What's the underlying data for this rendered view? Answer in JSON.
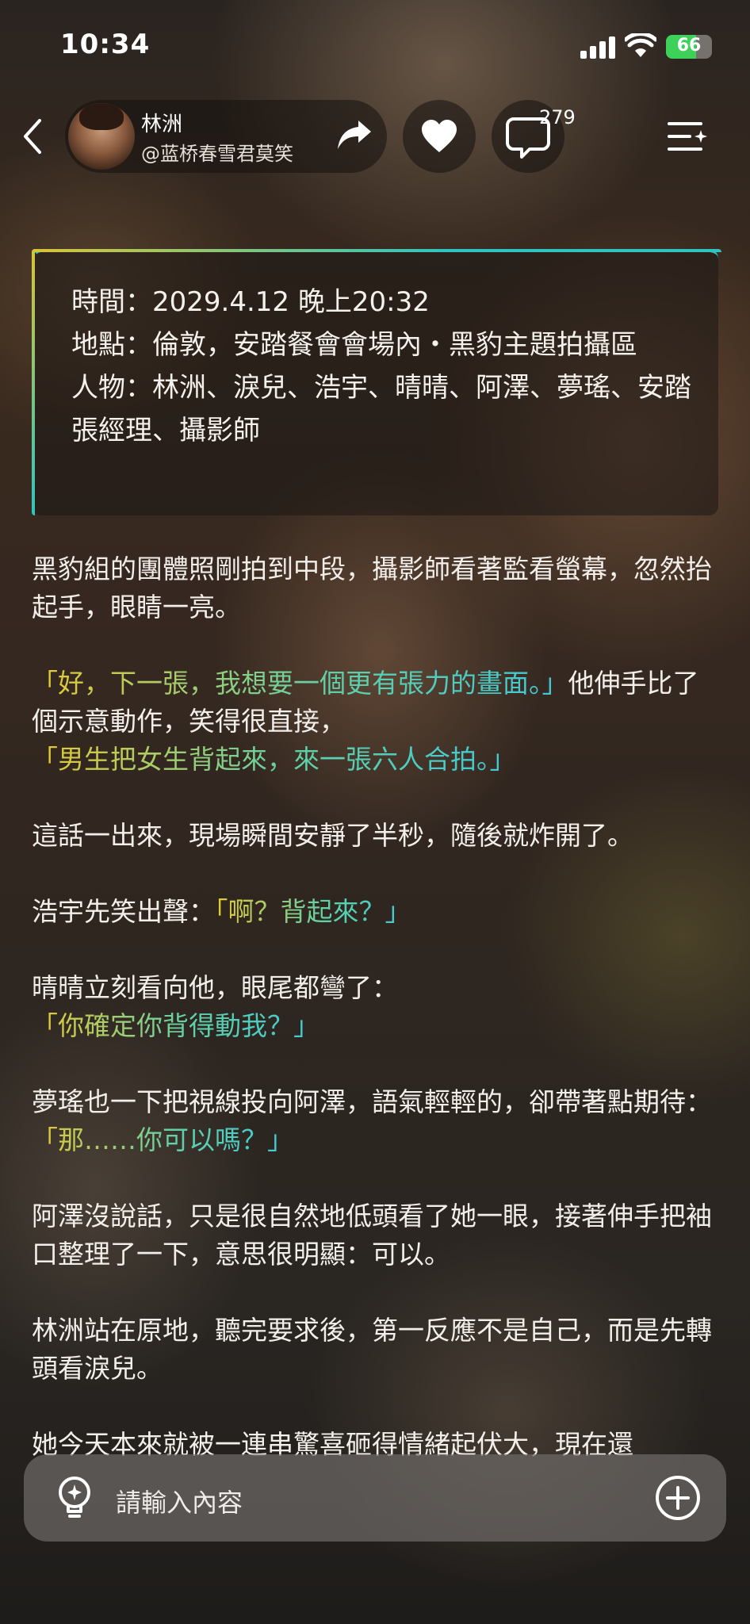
{
  "status": {
    "time": "10:34",
    "battery": "66"
  },
  "header": {
    "author_name": "林洲",
    "author_handle": "@蓝桥春雪君莫笑",
    "comment_count": "279"
  },
  "info": {
    "time_line": "時間：2029.4.12  晚上20:32",
    "place_line": "地點：倫敦，安踏餐會會場內・黑豹主題拍攝區",
    "people_line": "人物：林洲、淚兒、浩宇、晴晴、阿澤、夢瑤、安踏張經理、攝影師"
  },
  "story": {
    "p1": "黑豹組的團體照剛拍到中段，攝影師看著監看螢幕，忽然抬起手，眼睛一亮。",
    "p2_dialog": "「好，下一張，我想要一個更有張力的畫面。」",
    "p2_narr": "他伸手比了個示意動作，笑得很直接，",
    "p2_dialog2": "「男生把女生背起來，來一張六人合拍。」",
    "p3": "這話一出來，現場瞬間安靜了半秒，隨後就炸開了。",
    "p4_narr": "浩宇先笑出聲：",
    "p4_dialog": "「啊？背起來？」",
    "p5_narr": "晴晴立刻看向他，眼尾都彎了：",
    "p5_dialog": "「你確定你背得動我？」",
    "p6_narr": "夢瑤也一下把視線投向阿澤，語氣輕輕的，卻帶著點期待：",
    "p6_dialog": "「那……你可以嗎？」",
    "p7": "阿澤沒說話，只是很自然地低頭看了她一眼，接著伸手把袖口整理了一下，意思很明顯：可以。",
    "p8": "林洲站在原地，聽完要求後，第一反應不是自己，而是先轉頭看淚兒。",
    "p9": "她今天本來就被一連串驚喜砸得情緒起伏大，現在還"
  },
  "input": {
    "placeholder": "請輸入內容"
  },
  "colors": {
    "dialog_yellow": "#e6c832",
    "dialog_green": "#5ed4a6",
    "dialog_cyan": "#3fc6d8",
    "card_accent": "#2fc4c0"
  },
  "icons": [
    "back-arrow-icon",
    "share-icon",
    "heart-icon",
    "comment-icon",
    "menu-list-icon",
    "lightbulb-icon",
    "plus-circle-icon",
    "signal-icon",
    "wifi-icon",
    "battery-icon"
  ]
}
